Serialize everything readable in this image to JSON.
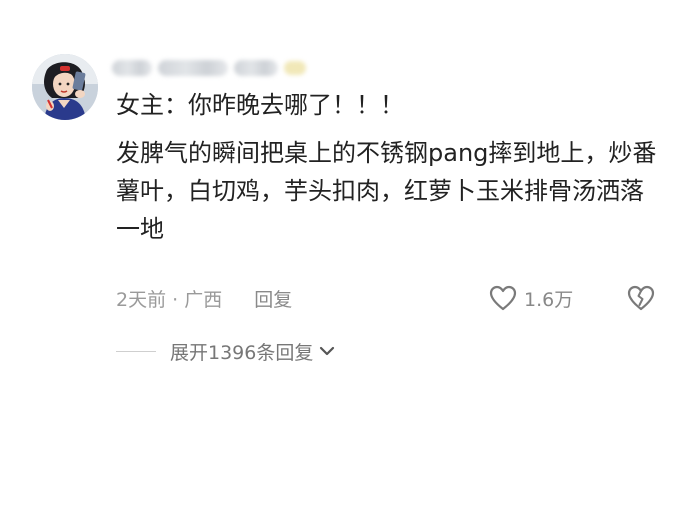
{
  "comment": {
    "author": {
      "avatar_icon": "avatar-illustration",
      "name_blurred": true
    },
    "lines": [
      "女主：你昨晚去哪了！！！",
      "发脾气的瞬间把桌上的不锈钢pang摔到地上，炒番薯叶，白切鸡，芋头扣肉，红萝卜玉米排骨汤洒落一地"
    ],
    "time_location": "2天前 · 广西",
    "reply_label": "回复",
    "like_icon": "heart-outline-icon",
    "like_count": "1.6万",
    "dislike_icon": "broken-heart-icon"
  },
  "replies": {
    "expand_label": "展开1396条回复",
    "expand_icon": "chevron-down-icon"
  },
  "colors": {
    "text": "#222222",
    "meta": "#9a9a9a",
    "background": "#ffffff"
  }
}
